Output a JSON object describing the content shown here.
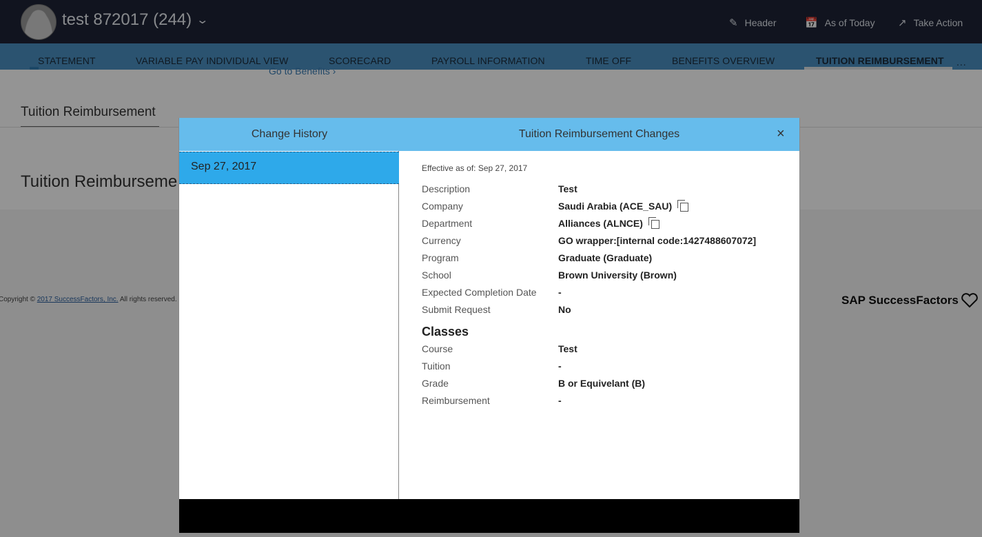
{
  "header": {
    "employee_name": "test 872017 (244)",
    "actions": [
      {
        "label": "Header",
        "icon": "pencil-icon"
      },
      {
        "label": "As of Today",
        "icon": "calendar-icon"
      },
      {
        "label": "Take Action",
        "icon": "external-link-icon"
      }
    ]
  },
  "tabs": [
    {
      "label": "STATEMENT"
    },
    {
      "label": "VARIABLE PAY INDIVIDUAL VIEW"
    },
    {
      "label": "SCORECARD"
    },
    {
      "label": "PAYROLL INFORMATION"
    },
    {
      "label": "TIME OFF"
    },
    {
      "label": "BENEFITS OVERVIEW"
    },
    {
      "label": "TUITION REIMBURSEMENT",
      "active": true
    }
  ],
  "tabs_more": "...",
  "page": {
    "go_to_benefits": "Go to Benefits",
    "section_tab": "Tuition Reimbursement",
    "section_heading": "Tuition Reimburseme"
  },
  "footer": {
    "copyright_prefix": "Copyright ©",
    "copyright_link": "2017 SuccessFactors, Inc.",
    "copyright_suffix": "All rights reserved.",
    "brand": "SAP SuccessFactors"
  },
  "dialog": {
    "history_title": "Change History",
    "history_items": [
      "Sep 27, 2017"
    ],
    "details_title": "Tuition Reimbursement Changes",
    "close_label": "×",
    "effective": "Effective as of: Sep 27, 2017",
    "fields": [
      {
        "label": "Description",
        "value": "Test"
      },
      {
        "label": "Company",
        "value": "Saudi Arabia (ACE_SAU)"
      },
      {
        "label": "Department",
        "value": "Alliances (ALNCE)"
      },
      {
        "label": "Currency",
        "value": "GO wrapper:[internal code:1427488607072]"
      },
      {
        "label": "Program",
        "value": "Graduate (Graduate)"
      },
      {
        "label": "School",
        "value": "Brown University (Brown)"
      },
      {
        "label": "Expected Completion Date",
        "value": "-"
      },
      {
        "label": "Submit Request",
        "value": "No"
      }
    ],
    "classes_title": "Classes",
    "classes": [
      {
        "label": "Course",
        "value": "Test"
      },
      {
        "label": "Tuition",
        "value": "-"
      },
      {
        "label": "Grade",
        "value": "B or Equivelant (B)"
      },
      {
        "label": "Reimbursement",
        "value": "-"
      }
    ]
  },
  "colors": {
    "topbar": "#1e2436",
    "tabbar": "#4a90c2",
    "dialog_header": "#66bcec",
    "history_selected": "#2ea9ea"
  }
}
